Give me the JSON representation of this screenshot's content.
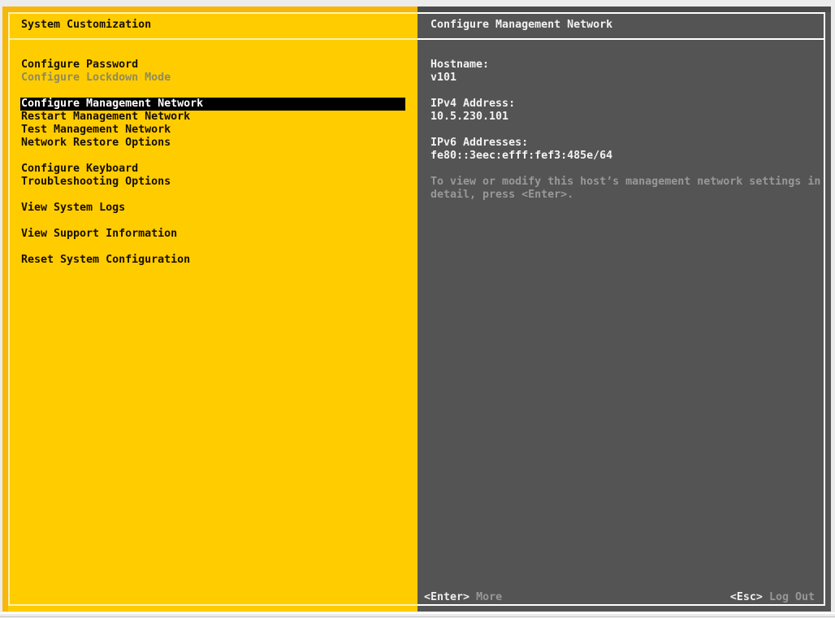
{
  "left_panel": {
    "title": "System Customization",
    "menu": [
      {
        "label": "Configure Password",
        "state": "normal"
      },
      {
        "label": "Configure Lockdown Mode",
        "state": "disabled"
      },
      {
        "label": "",
        "state": "spacer"
      },
      {
        "label": "Configure Management Network",
        "state": "selected"
      },
      {
        "label": "Restart Management Network",
        "state": "normal"
      },
      {
        "label": "Test Management Network",
        "state": "normal"
      },
      {
        "label": "Network Restore Options",
        "state": "normal"
      },
      {
        "label": "",
        "state": "spacer"
      },
      {
        "label": "Configure Keyboard",
        "state": "normal"
      },
      {
        "label": "Troubleshooting Options",
        "state": "normal"
      },
      {
        "label": "",
        "state": "spacer"
      },
      {
        "label": "View System Logs",
        "state": "normal"
      },
      {
        "label": "",
        "state": "spacer"
      },
      {
        "label": "View Support Information",
        "state": "normal"
      },
      {
        "label": "",
        "state": "spacer"
      },
      {
        "label": "Reset System Configuration",
        "state": "normal"
      }
    ]
  },
  "right_panel": {
    "title": "Configure Management Network",
    "fields": [
      {
        "label": "Hostname:",
        "value": "v101"
      },
      {
        "label": "IPv4 Address:",
        "value": "10.5.230.101"
      },
      {
        "label": "IPv6 Addresses:",
        "value": "fe80::3eec:efff:fef3:485e/64"
      }
    ],
    "note": "To view or modify this host’s management network settings in detail, press <Enter>.",
    "hints": {
      "enter_key": "<Enter>",
      "enter_label": "More",
      "esc_key": "<Esc>",
      "esc_label": "Log Out"
    }
  },
  "colors": {
    "desktop_bg": "#ececec",
    "panel_yellow": "#ffcc00",
    "panel_yellow_edge": "#f6b70a",
    "panel_yellow_border": "#fff3ac",
    "panel_gray": "#545454",
    "panel_gray_edge": "#4b4b4b",
    "panel_gray_border": "#ffffff",
    "menu_text": "#181000",
    "menu_disabled_text": "#8e8b60",
    "selected_bg": "#000000",
    "selected_text": "#ffffff",
    "info_text": "#f2f2f2",
    "muted_text": "#989898",
    "hint_key_text": "#eeeeee",
    "hint_label_text": "#979797"
  }
}
